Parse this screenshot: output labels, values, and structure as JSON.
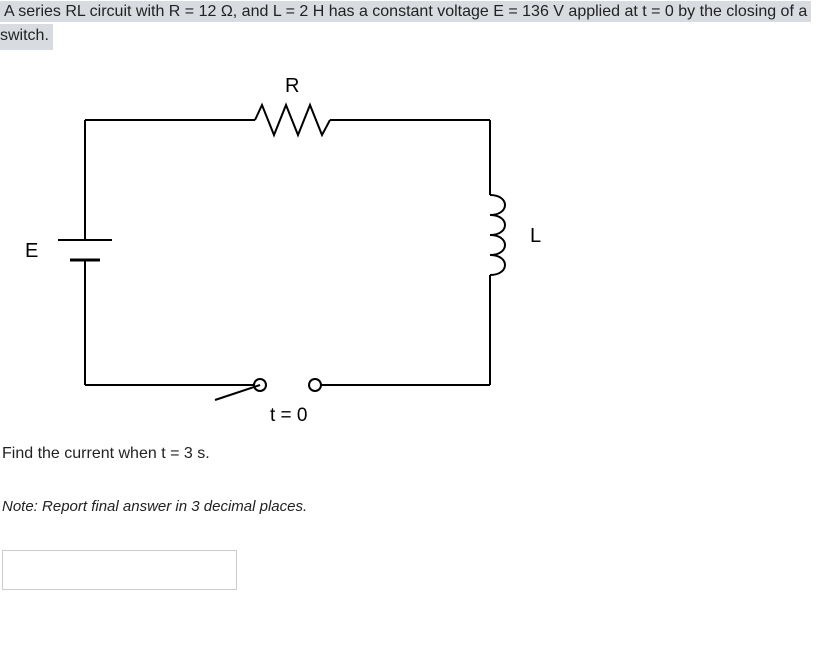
{
  "problem": {
    "line1": "A series RL circuit with R = 12 Ω, and L = 2 H has a constant voltage E = 136 V applied at t = 0 by the closing of a",
    "line2": "switch."
  },
  "circuit": {
    "label_R": "R",
    "label_E": "E",
    "label_L": "L",
    "label_t": "t = 0"
  },
  "question": "Find the current when t = 3 s.",
  "note": "Note: Report final answer in 3 decimal places.",
  "answer_placeholder": ""
}
